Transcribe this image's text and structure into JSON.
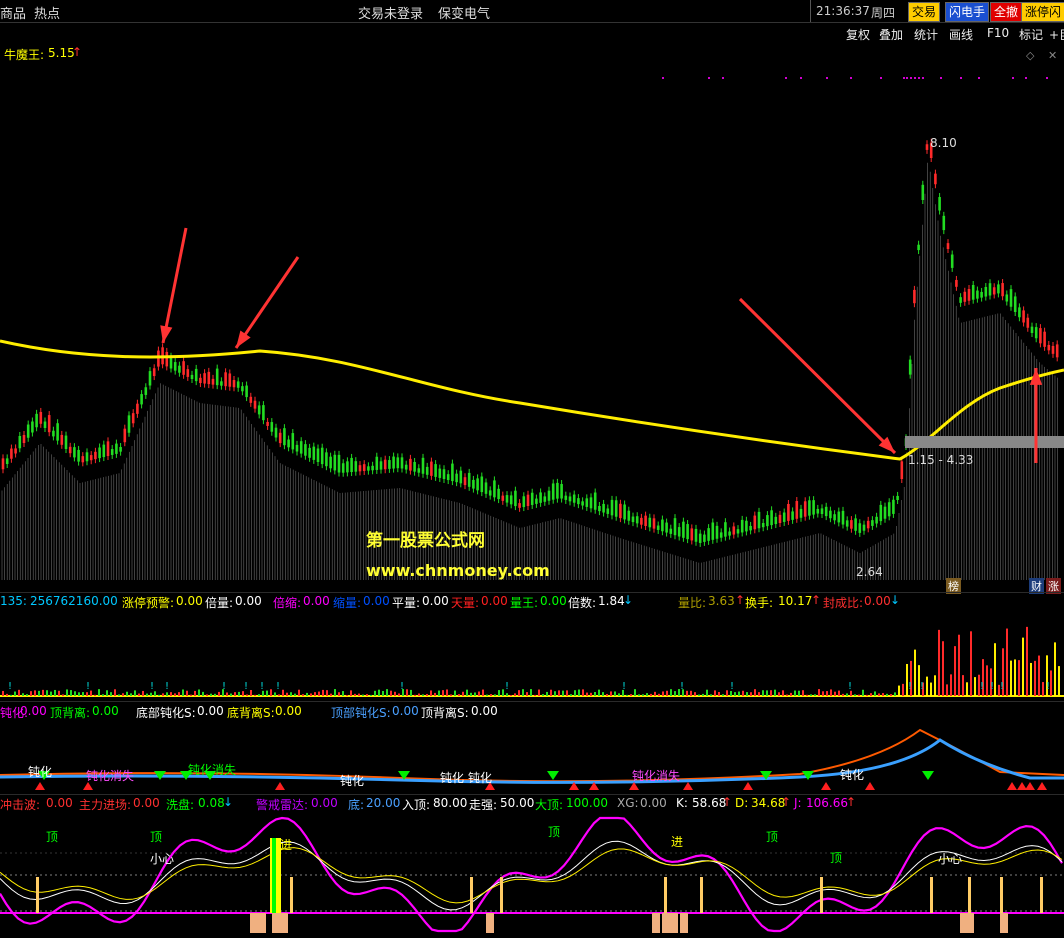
{
  "topbar": {
    "menu_left_1": "商品",
    "menu_left_2": "热点",
    "login_status": "交易未登录",
    "stock_name": "保变电气",
    "time": "21:36:37",
    "weekday": "周四",
    "btn_trade": "交易",
    "btn_flash": "闪电手",
    "btn_cancel": "全撤",
    "btn_limit": "涨停闪买"
  },
  "toolbar": {
    "restore": "复权",
    "overlay": "叠加",
    "stats": "统计",
    "draw": "画线",
    "f10": "F10",
    "mark": "标记",
    "plus": "+巨"
  },
  "main_chart": {
    "indicator_name": "牛魔王:",
    "indicator_value": "5.15",
    "high_label": "8.10",
    "low_label": "2.64",
    "range_label": "1.15 - 4.33",
    "watermark_cn": "第一股票公式网",
    "watermark_url": "www.chnmoney.com",
    "tag_bang": "榜",
    "tag_cai": "财",
    "tag_zhang": "涨"
  },
  "vol_panel": {
    "items": [
      {
        "label": "135:",
        "value": "256762160.00",
        "color": "#00c8ff"
      },
      {
        "label": "涨停预警:",
        "value": "0.00",
        "color": "#ffff00"
      },
      {
        "label": "倍量:",
        "value": "0.00",
        "color": "#ffffff"
      },
      {
        "label": "倍缩:",
        "value": "0.00",
        "color": "#ff00ff"
      },
      {
        "label": "缩量:",
        "value": "0.00",
        "color": "#0050ff"
      },
      {
        "label": "平量:",
        "value": "0.00",
        "color": "#ffffff"
      },
      {
        "label": "天量:",
        "value": "0.00",
        "color": "#ff2020"
      },
      {
        "label": "量王:",
        "value": "0.00",
        "color": "#00ff00"
      },
      {
        "label": "倍数:",
        "value": "1.84",
        "color": "#ffffff"
      },
      {
        "label": "量比:",
        "value": "3.63",
        "color": "#b0a000"
      },
      {
        "label": "换手:",
        "value": "10.17",
        "color": "#ffff00"
      },
      {
        "label": "封成比:",
        "value": "0.00",
        "color": "#ff3030"
      }
    ]
  },
  "div_panel": {
    "items": [
      {
        "label": "钝化:",
        "value": "0.00",
        "color": "#ff00ff"
      },
      {
        "label": "顶背离:",
        "value": "0.00",
        "color": "#00ff00"
      },
      {
        "label": "底部钝化S:",
        "value": "0.00",
        "color": "#ffffff"
      },
      {
        "label": "底背离S:",
        "value": "0.00",
        "color": "#ffff00"
      },
      {
        "label": "顶部钝化S:",
        "value": "0.00",
        "color": "#4aa0ff"
      },
      {
        "label": "顶背离S:",
        "value": "0.00",
        "color": "#ffffff"
      }
    ],
    "word_dunhua": "钝化",
    "word_fenshi": "钝化消失"
  },
  "kdj_panel": {
    "items": [
      {
        "label": "冲击波:",
        "value": "0.00",
        "color": "#ff3030"
      },
      {
        "label": "主力进场:",
        "value": "0.00",
        "color": "#ff3030"
      },
      {
        "label": "洗盘:",
        "value": "0.08",
        "color": "#00ff00"
      },
      {
        "label": "警戒雷达:",
        "value": "0.00",
        "color": "#c000ff"
      },
      {
        "label": "底:",
        "value": "20.00",
        "color": "#4aa0ff"
      },
      {
        "label": "入顶:",
        "value": "80.00",
        "color": "#ffffff"
      },
      {
        "label": "走强:",
        "value": "50.00",
        "color": "#ffffff"
      },
      {
        "label": "大顶:",
        "value": "100.00",
        "color": "#00ff00"
      },
      {
        "label": "XG:",
        "value": "0.00",
        "color": "#aaaaaa"
      },
      {
        "label": "K:",
        "value": "58.68",
        "color": "#ffffff"
      },
      {
        "label": "D:",
        "value": "34.68",
        "color": "#ffff00"
      },
      {
        "label": "J:",
        "value": "106.66",
        "color": "#ff00ff"
      }
    ],
    "word_top": "顶",
    "word_in": "进",
    "word_careful": "小心"
  }
}
